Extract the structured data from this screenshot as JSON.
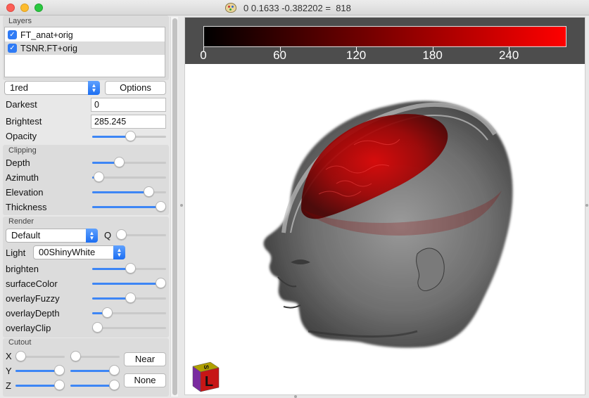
{
  "window": {
    "title": "0 0.1633 -0.382202 =  818"
  },
  "layers": {
    "section_label": "Layers",
    "items": [
      {
        "name": "FT_anat+orig",
        "checked": true
      },
      {
        "name": "TSNR.FT+orig",
        "checked": true
      }
    ]
  },
  "colormap": {
    "selected": "1red",
    "options_button": "Options",
    "darkest_label": "Darkest",
    "darkest_value": "0",
    "brightest_label": "Brightest",
    "brightest_value": "285.245",
    "opacity_label": "Opacity",
    "opacity_value": 0.52
  },
  "clipping": {
    "section_label": "Clipping",
    "depth_label": "Depth",
    "depth_value": 0.34,
    "azimuth_label": "Azimuth",
    "azimuth_value": 0.02,
    "elevation_label": "Elevation",
    "elevation_value": 0.81,
    "thickness_label": "Thickness",
    "thickness_value": 1.0
  },
  "render": {
    "section_label": "Render",
    "shader_selected": "Default",
    "q_label": "Q",
    "q_value": 0.0,
    "light_label": "Light",
    "light_selected": "00ShinyWhite",
    "brighten_label": "brighten",
    "brighten_value": 0.52,
    "surfacecolor_label": "surfaceColor",
    "surfacecolor_value": 1.0,
    "overlayfuzzy_label": "overlayFuzzy",
    "overlayfuzzy_value": 0.52,
    "overlaydepth_label": "overlayDepth",
    "overlaydepth_value": 0.15,
    "overlayclip_label": "overlayClip",
    "overlayclip_value": 0.0
  },
  "cutout": {
    "section_label": "Cutout",
    "x_label": "X",
    "y_label": "Y",
    "z_label": "Z",
    "near_button": "Near",
    "none_button": "None",
    "x_lo": 0.0,
    "x_hi": 0.0,
    "y_lo": 1.0,
    "y_hi": 1.0,
    "z_lo": 1.0,
    "z_hi": 1.0
  },
  "colorbar": {
    "ticks": [
      "0",
      "60",
      "120",
      "180",
      "240"
    ],
    "tick_values": [
      0,
      60,
      120,
      180,
      240
    ],
    "min": 0,
    "max": 285.245,
    "color_low": "#000000",
    "color_high": "#ff0000"
  },
  "orientation_cube": {
    "front_letter": "L",
    "top_letter": "S"
  },
  "colors": {
    "accent": "#3d86f5",
    "overlay_red": "#c40000"
  }
}
